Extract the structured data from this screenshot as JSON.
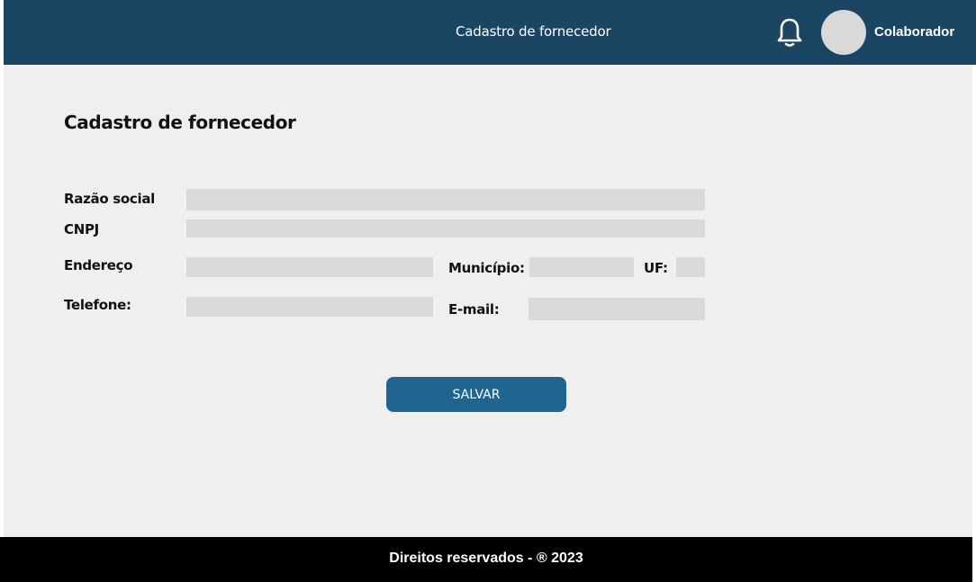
{
  "header": {
    "title": "Cadastro de fornecedor",
    "bell_icon": "bell-icon",
    "user_name": "Colaborador",
    "background_color": "#1a4563"
  },
  "page": {
    "title": "Cadastro de fornecedor"
  },
  "form": {
    "razao_social": {
      "label": "Razão social",
      "value": ""
    },
    "cnpj": {
      "label": "CNPJ",
      "value": ""
    },
    "endereco": {
      "label": "Endereço",
      "value": ""
    },
    "municipio": {
      "label": "Município:",
      "value": ""
    },
    "uf": {
      "label": "UF:",
      "value": ""
    },
    "telefone": {
      "label": "Telefone:",
      "value": ""
    },
    "email": {
      "label": "E-mail:",
      "value": ""
    },
    "save_label": "SALVAR",
    "button_color": "#206590"
  },
  "footer": {
    "text": "Direitos reservados - ® 2023"
  }
}
